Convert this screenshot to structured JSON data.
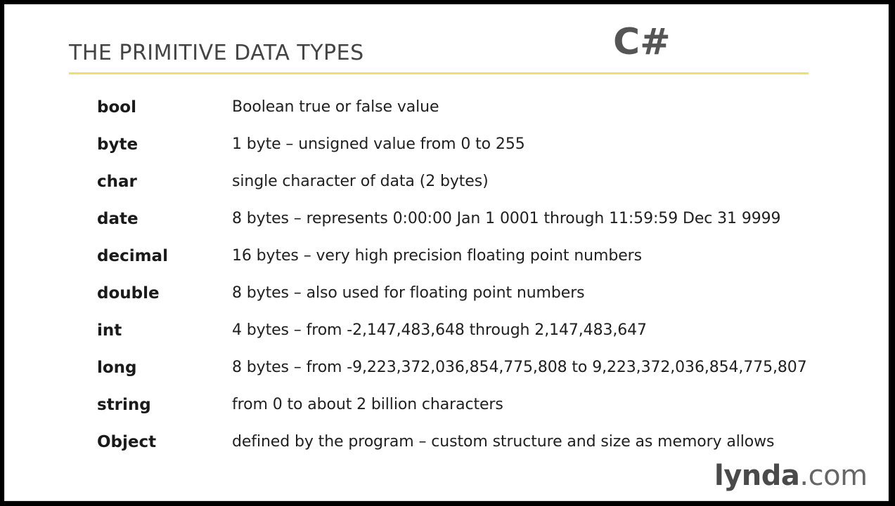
{
  "slide": {
    "title": "THE PRIMITIVE DATA TYPES",
    "language": "C#",
    "accent_color": "#ece26a",
    "rows": [
      {
        "type": "bool",
        "description": "Boolean true or false value"
      },
      {
        "type": "byte",
        "description": "1 byte – unsigned value from 0 to 255"
      },
      {
        "type": "char",
        "description": "single character of data (2 bytes)"
      },
      {
        "type": "date",
        "description": "8 bytes – represents 0:00:00 Jan 1 0001 through 11:59:59 Dec 31 9999"
      },
      {
        "type": "decimal",
        "description": "16 bytes – very high precision floating point numbers"
      },
      {
        "type": "double",
        "description": "8 bytes – also used for floating point numbers"
      },
      {
        "type": "int",
        "description": "4 bytes – from -2,147,483,648 through 2,147,483,647"
      },
      {
        "type": "long",
        "description": "8 bytes – from -9,223,372,036,854,775,808 to 9,223,372,036,854,775,807"
      },
      {
        "type": "string",
        "description": "from 0 to about 2 billion characters"
      },
      {
        "type": "Object",
        "description": "defined by the program – custom structure and size as memory allows"
      }
    ]
  },
  "logo": {
    "brand": "lynda",
    "tld": ".com"
  }
}
